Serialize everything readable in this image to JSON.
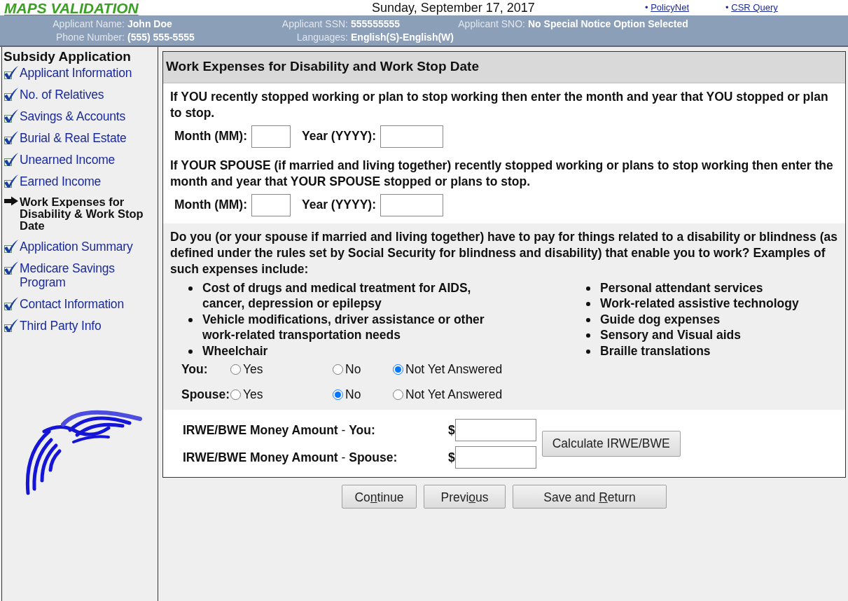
{
  "header": {
    "title": "MAPS VALIDATION",
    "date": "Sunday, September 17, 2017",
    "links": [
      {
        "bullet": "•",
        "label": "PolicyNet"
      },
      {
        "bullet": "•",
        "label": "CSR Query"
      }
    ]
  },
  "applicant_bar": {
    "fields": [
      {
        "label": "Applicant Name:",
        "value": "John Doe"
      },
      {
        "label": "Applicant SSN:",
        "value": "555555555"
      },
      {
        "label": "Applicant SNO:",
        "value": "No Special Notice Option Selected"
      },
      {
        "label": "Phone Number:",
        "value": "(555) 555-5555"
      },
      {
        "label": "Languages:",
        "value": "English(S)-English(W)"
      }
    ]
  },
  "sidebar": {
    "title": "Subsidy Application",
    "items": [
      {
        "label": "Applicant Information",
        "kind": "done"
      },
      {
        "label": "No. of Relatives",
        "kind": "done"
      },
      {
        "label": "Savings & Accounts",
        "kind": "done"
      },
      {
        "label": "Burial & Real Estate",
        "kind": "done"
      },
      {
        "label": "Unearned Income",
        "kind": "done"
      },
      {
        "label": "Earned Income",
        "kind": "done"
      },
      {
        "label": "Work Expenses for Disability & Work Stop Date",
        "kind": "current"
      },
      {
        "label": "Application Summary",
        "kind": "done"
      },
      {
        "label": "Medicare Savings Program",
        "kind": "done"
      },
      {
        "label": "Contact Information",
        "kind": "done"
      },
      {
        "label": "Third Party Info",
        "kind": "done"
      }
    ]
  },
  "form": {
    "title": "Work Expenses for Disability and Work Stop Date",
    "stop_date_questions": [
      {
        "text": "If YOU recently stopped working or plan to stop working then enter the month and year that YOU stopped or plan to stop.",
        "month_label": "Month (MM):",
        "year_label": "Year (YYYY):"
      },
      {
        "text": "If YOUR SPOUSE (if married and living together) recently stopped working or plans to stop working then enter the month and year that YOUR SPOUSE stopped or plans to stop.",
        "month_label": "Month (MM):",
        "year_label": "Year (YYYY):"
      }
    ],
    "expense_question": "Do you (or your spouse if married and living together) have to pay for things related to a disability or blindness (as defined under the rules set by Social Security for blindness and disability) that enable you to work? Examples of such expenses include:",
    "examples_columns": [
      {
        "items": [
          "Cost of drugs and medical treatment for AIDS, cancer, depression or epilepsy",
          "Vehicle modifications, driver assistance or other work-related transportation needs",
          "Wheelchair"
        ]
      },
      {
        "items": [
          "Personal attendant services",
          "Work-related assistive technology",
          "Guide dog expenses",
          "Sensory and Visual aids",
          "Braille translations"
        ]
      }
    ],
    "answers": [
      {
        "label": "You:",
        "options": [
          {
            "label": "Yes",
            "selected": false
          },
          {
            "label": "No",
            "selected": false
          },
          {
            "label": "Not Yet Answered",
            "selected": true
          }
        ]
      },
      {
        "label": "Spouse:",
        "options": [
          {
            "label": "Yes",
            "selected": false
          },
          {
            "label": "No",
            "selected": true
          },
          {
            "label": "Not Yet Answered",
            "selected": false
          }
        ]
      }
    ],
    "amounts": [
      {
        "label": "**IRWE/BWE Money Amount** - **You:**",
        "currency": "$"
      },
      {
        "label": "**IRWE/BWE Money Amount** - **Spouse:**",
        "currency": "$"
      }
    ],
    "calculate_button": "Calculate IRWE/BWE"
  },
  "buttons": [
    {
      "before": "Co",
      "key": "n",
      "after": "tinue"
    },
    {
      "before": "Previ",
      "key": "o",
      "after": "us"
    },
    {
      "before": "Save and ",
      "key": "R",
      "after": "eturn"
    }
  ]
}
